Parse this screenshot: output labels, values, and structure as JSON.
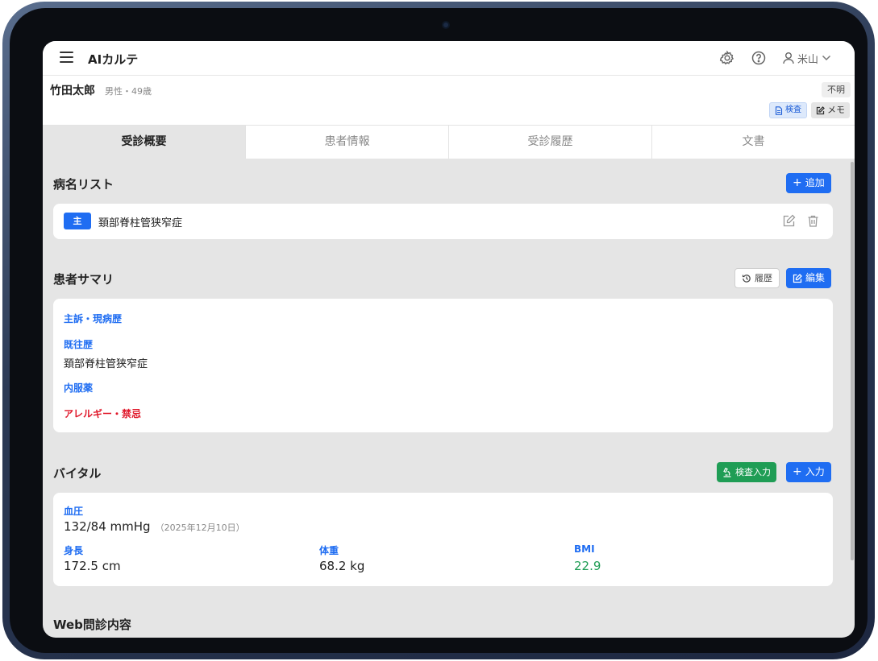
{
  "app": {
    "title": "AIカルテ"
  },
  "header": {
    "user_name": "米山"
  },
  "patient": {
    "name": "竹田太郎",
    "info": "男性・49歳",
    "status_badge": "不明",
    "exam_button": "検査",
    "memo_button": "メモ"
  },
  "tabs": [
    {
      "label": "受診概要",
      "active": true
    },
    {
      "label": "患者情報",
      "active": false
    },
    {
      "label": "受診履歴",
      "active": false
    },
    {
      "label": "文書",
      "active": false
    }
  ],
  "diagnosis_list": {
    "title": "病名リスト",
    "add_button": "追加",
    "items": [
      {
        "badge": "主",
        "name": "頚部脊柱管狭窄症"
      }
    ]
  },
  "summary": {
    "title": "患者サマリ",
    "history_button": "履歴",
    "edit_button": "編集",
    "chief_complaint_label": "主訴・現病歴",
    "past_history_label": "既往歴",
    "past_history_value": "頚部脊柱管狭窄症",
    "medication_label": "内服薬",
    "allergy_label": "アレルギー・禁忌"
  },
  "vitals": {
    "title": "バイタル",
    "exam_input_button": "検査入力",
    "input_button": "入力",
    "bp_label": "血圧",
    "bp_value": "132/84 mmHg",
    "bp_date": "（2025年12月10日）",
    "height_label": "身長",
    "height_value": "172.5 cm",
    "weight_label": "体重",
    "weight_value": "68.2 kg",
    "bmi_label": "BMI",
    "bmi_value": "22.9"
  },
  "web_interview": {
    "title": "Web問診内容"
  },
  "colors": {
    "primary": "#1f6df2",
    "green": "#1f9d55",
    "red": "#e0192b"
  }
}
